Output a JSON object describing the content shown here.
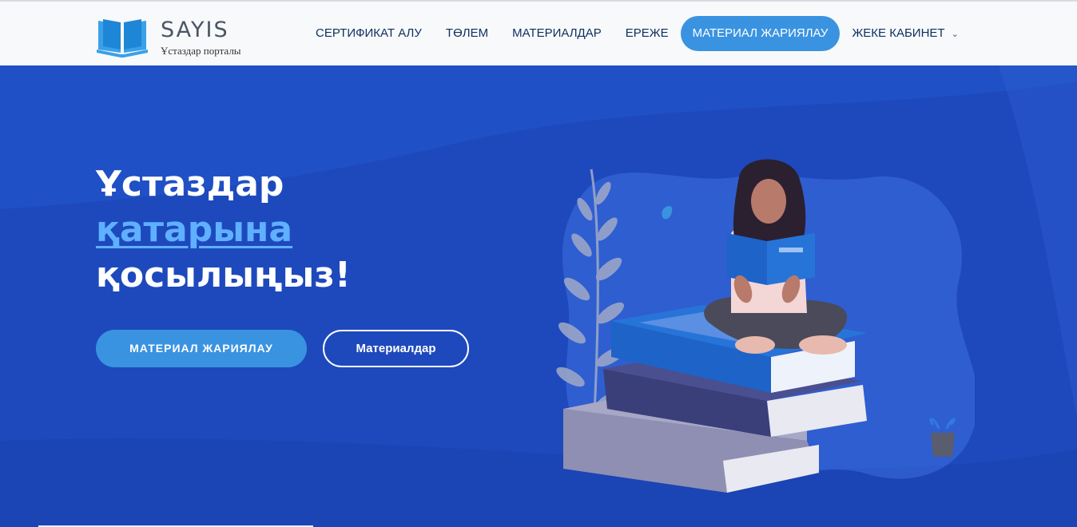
{
  "brand": {
    "name": "SAYIS",
    "subtitle": "Ұстаздар порталы",
    "logo_icon": "open-book-icon",
    "logo_color": "#3aa0e8"
  },
  "nav": {
    "items": [
      {
        "label": "СЕРТИФИКАТ АЛУ"
      },
      {
        "label": "ТӨЛЕМ"
      },
      {
        "label": "МАТЕРИАЛДАР"
      },
      {
        "label": "ЕРЕЖЕ"
      },
      {
        "label": "МАТЕРИАЛ ЖАРИЯЛАУ",
        "active": true
      },
      {
        "label": "ЖЕКЕ КАБИНЕТ",
        "dropdown": true
      }
    ],
    "caret": "⌄"
  },
  "hero": {
    "line1": "Ұстаздар",
    "line2": "қатарына",
    "line3": "қосылыңыз!",
    "primary_button": "МАТЕРИАЛ ЖАРИЯЛАУ",
    "secondary_button": "Материалдар",
    "illustration": "woman-reading-on-books-illustration"
  },
  "colors": {
    "hero_bg": "#1e49bd",
    "accent": "#3a93e0",
    "highlight_text": "#5fb0ff",
    "header_bg": "#f7f9fb"
  }
}
